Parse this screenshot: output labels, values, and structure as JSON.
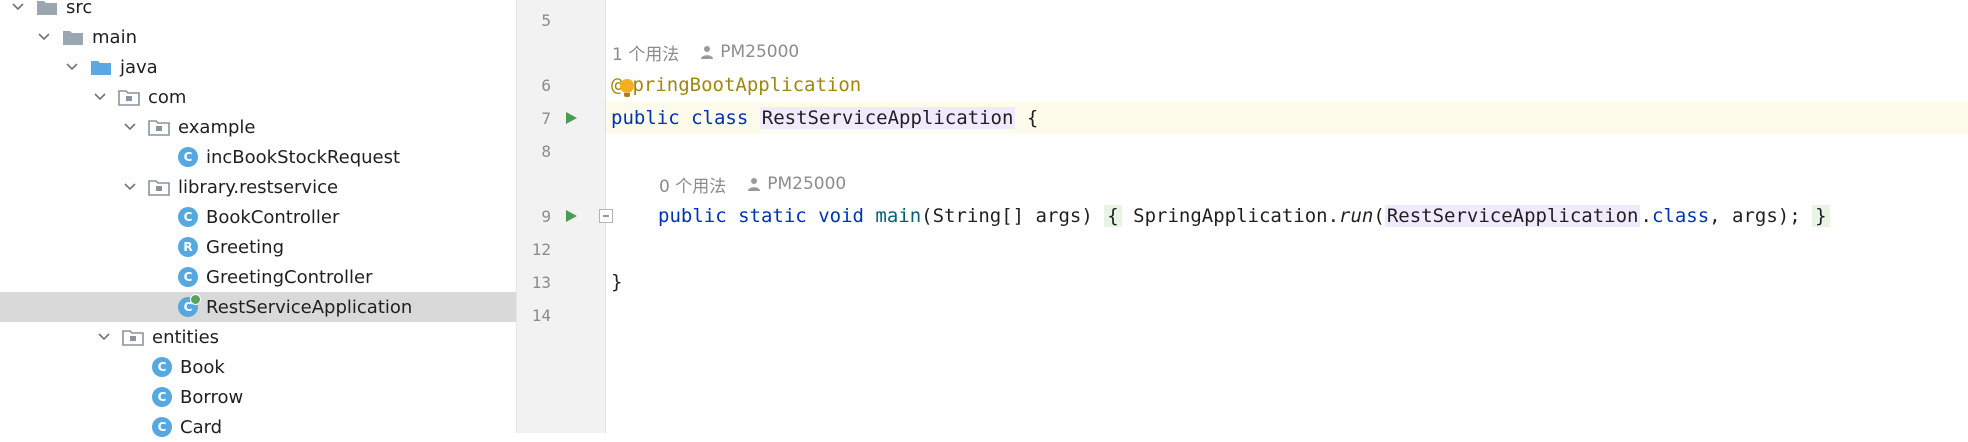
{
  "project_tree": {
    "items": [
      {
        "label": "src",
        "kind": "folder",
        "expanded": true
      },
      {
        "label": "main",
        "kind": "folder",
        "expanded": true
      },
      {
        "label": "java",
        "kind": "source-folder",
        "expanded": true
      },
      {
        "label": "com",
        "kind": "package",
        "expanded": true
      },
      {
        "label": "example",
        "kind": "package",
        "expanded": true
      },
      {
        "label": "incBookStockRequest",
        "kind": "class",
        "letter": "C"
      },
      {
        "label": "library.restservice",
        "kind": "package",
        "expanded": true
      },
      {
        "label": "BookController",
        "kind": "class",
        "letter": "C"
      },
      {
        "label": "Greeting",
        "kind": "record",
        "letter": "R"
      },
      {
        "label": "GreetingController",
        "kind": "class",
        "letter": "C"
      },
      {
        "label": "RestServiceApplication",
        "kind": "class-runnable",
        "letter": "C",
        "selected": true
      },
      {
        "label": "entities",
        "kind": "package",
        "expanded": true
      },
      {
        "label": "Book",
        "kind": "entity",
        "letter": "C"
      },
      {
        "label": "Borrow",
        "kind": "entity",
        "letter": "C"
      },
      {
        "label": "Card",
        "kind": "entity",
        "letter": "C"
      }
    ]
  },
  "editor": {
    "line_numbers": [
      "5",
      "6",
      "7",
      "8",
      "9",
      "12",
      "13",
      "14"
    ],
    "usage_hint_1": {
      "usages": "1 个用法",
      "author": "PM25000"
    },
    "usage_hint_2": {
      "usages": "0 个用法",
      "author": "PM25000"
    },
    "code": {
      "annotation_at": "@",
      "annotation_rest": "pringBootApplication",
      "kw_public": "public",
      "kw_class": "class",
      "class_name": "RestServiceApplication",
      "open_brace": "{",
      "kw_static": "static",
      "kw_void": "void",
      "method_name": "main",
      "params": "(String[] args)",
      "body_open": "{",
      "spring_app": "SpringApplication.",
      "run_call": "run",
      "paren_open": "(",
      "ref_class": "RestServiceApplication",
      "dot": ".",
      "kw_class_literal": "class",
      "args_end": ", args);",
      "body_close": "}",
      "close_brace": "}"
    },
    "colors": {
      "keyword": "#0033b3",
      "annotation": "#9e880d",
      "method": "#00627a",
      "run_icon": "#499c54",
      "class_icon": "#55a8e0",
      "current_line": "#fdfbea"
    }
  }
}
